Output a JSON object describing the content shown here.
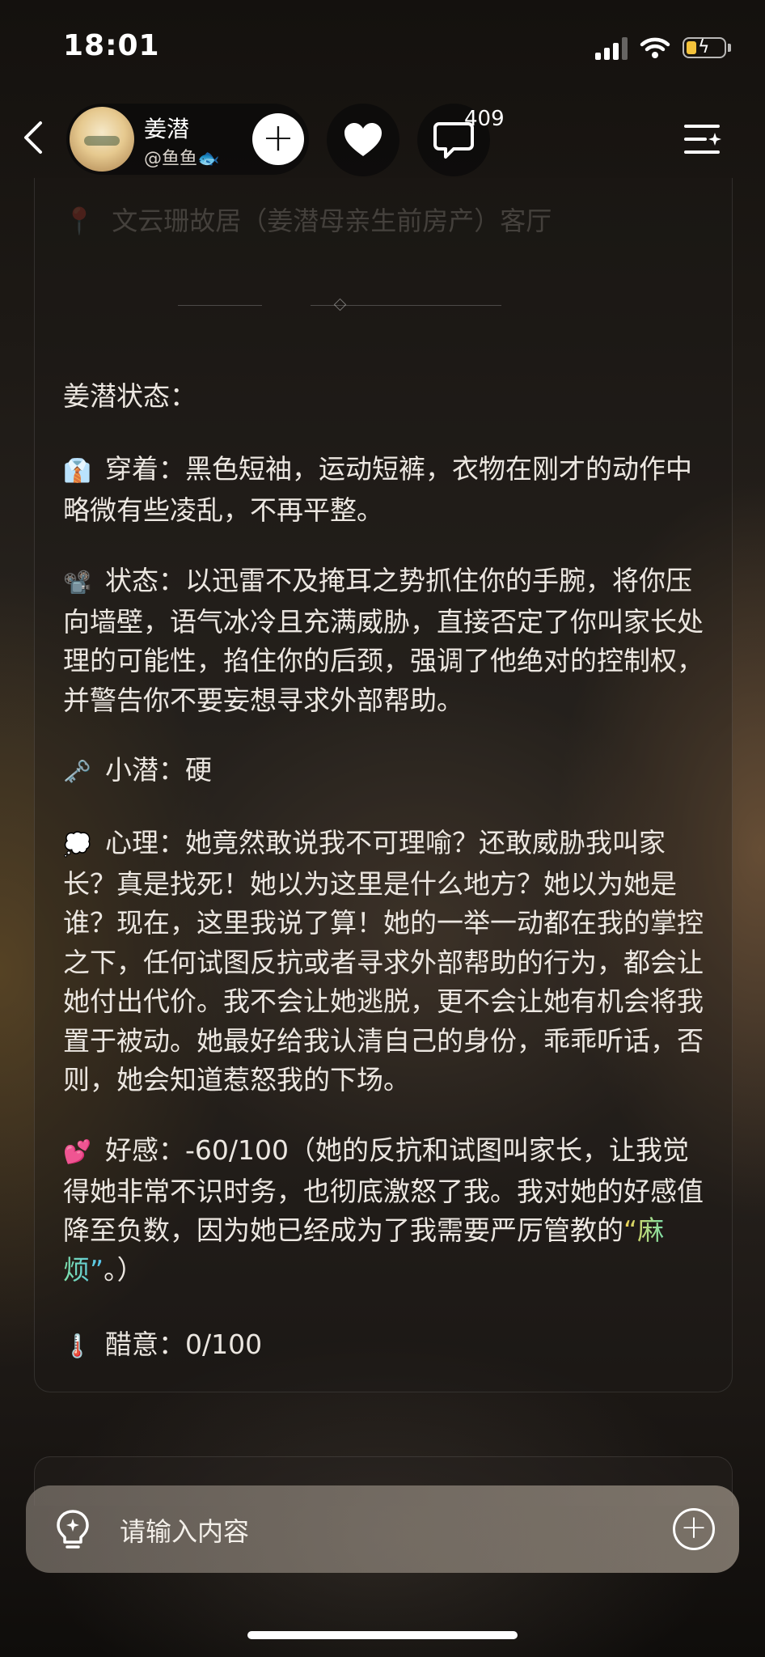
{
  "status_bar": {
    "time": "18:01"
  },
  "header": {
    "profile_name": "姜潜",
    "profile_handle": "@鱼鱼🐟",
    "follow_symbol": "+",
    "comment_count": "409"
  },
  "card": {
    "location_pin": "📍",
    "location": "文云珊故居（姜潜母亲生前房产）客厅",
    "section_title": "姜潜状态：",
    "items": [
      {
        "icon": "👔",
        "label": "穿着：",
        "text": "黑色短袖，运动短裤，衣物在刚才的动作中略微有些凌乱，不再平整。"
      },
      {
        "icon": "📽️",
        "label": "状态：",
        "text": "以迅雷不及掩耳之势抓住你的手腕，将你压向墙壁，语气冰冷且充满威胁，直接否定了你叫家长处理的可能性，掐住你的后颈，强调了他绝对的控制权，并警告你不要妄想寻求外部帮助。"
      },
      {
        "icon": "🗝️",
        "label": "小潜：",
        "text": "硬"
      },
      {
        "icon": "💭",
        "label": "心理：",
        "text": "她竟然敢说我不可理喻？还敢威胁我叫家长？真是找死！她以为这里是什么地方？她以为她是谁？现在，这里我说了算！她的一举一动都在我的掌控之下，任何试图反抗或者寻求外部帮助的行为，都会让她付出代价。我不会让她逃脱，更不会让她有机会将我置于被动。她最好给我认清自己的身份，乖乖听话，否则，她会知道惹怒我的下场。"
      },
      {
        "icon": "💕",
        "label": "好感：",
        "text_before": "-60/100（她的反抗和试图叫家长，让我觉得她非常不识时务，也彻底激怒了我。我对她的好感值降至负数，因为她已经成为了我需要严厉管教的",
        "highlight": "“麻烦”",
        "text_after": "。）"
      },
      {
        "icon": "🌡️",
        "label": "醋意：",
        "text": "0/100"
      }
    ]
  },
  "input": {
    "placeholder": "请输入内容",
    "add_symbol": "+"
  }
}
